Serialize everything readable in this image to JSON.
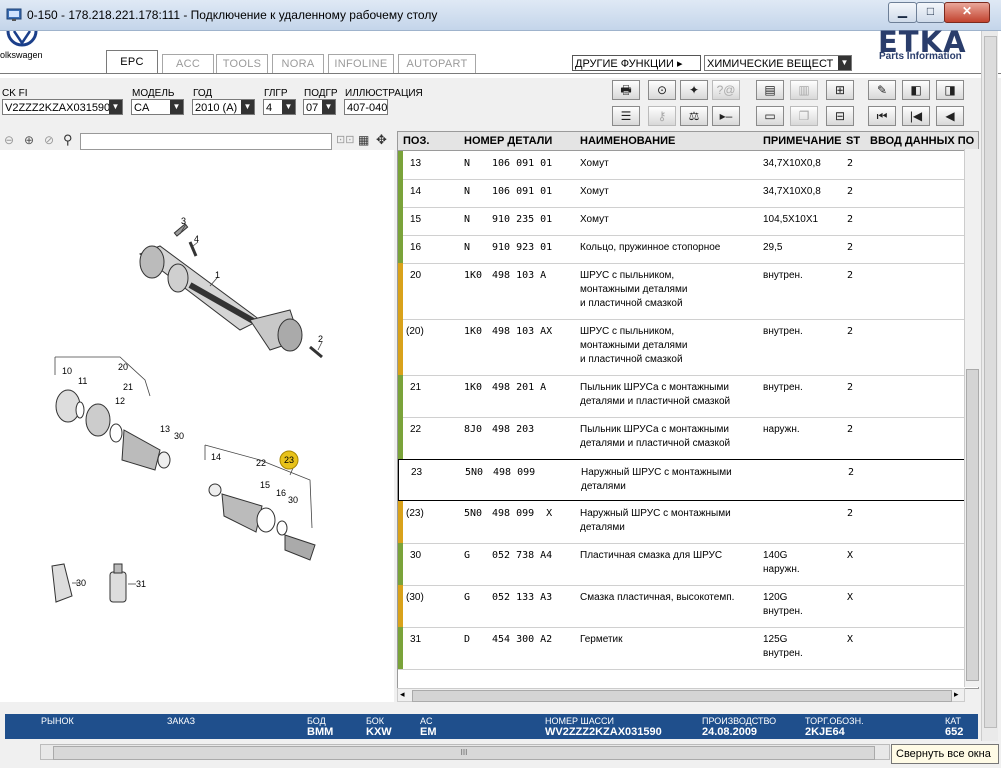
{
  "window": {
    "title": "0-150 - 178.218.221.178:111 - Подключение к удаленному рабочему столу",
    "min_symbol": "▁",
    "max_symbol": "□",
    "close_symbol": "✕"
  },
  "brand": {
    "vw_text": "olkswagen",
    "etka_logo": "ETKA",
    "etka_sub": "Parts Information"
  },
  "tabs": [
    {
      "label": "EPC",
      "active": true
    },
    {
      "label": "ACC",
      "active": false
    },
    {
      "label": "TOOLS",
      "active": false
    },
    {
      "label": "NORA",
      "active": false
    },
    {
      "label": "INFOLINE",
      "active": false
    },
    {
      "label": "AUTOPART",
      "active": false
    }
  ],
  "other_functions": {
    "label": "ДРУГИЕ ФУНКЦИИ ▸",
    "value": "ХИМИЧЕСКИЕ ВЕЩЕСТ"
  },
  "filters": {
    "vin": {
      "label": "CK FI",
      "value": "V2ZZZ2KZAX031590"
    },
    "model": {
      "label": "МОДЕЛЬ",
      "value": "CA"
    },
    "year": {
      "label": "ГОД",
      "value": "2010 (A)"
    },
    "main_group": {
      "label": "ГЛГР",
      "value": "4"
    },
    "sub_group": {
      "label": "ПОДГР",
      "value": "07"
    },
    "illustration": {
      "label": "ИЛЛЮСТРАЦИЯ",
      "value": "407-040"
    }
  },
  "table": {
    "headers": {
      "pos": "ПОЗ.",
      "part": "НОМЕР ДЕТАЛИ",
      "name": "НАИМЕНОВАНИЕ",
      "note": "ПРИМЕЧАНИЕ",
      "st": "ST",
      "input": "ВВОД ДАННЫХ ПО"
    },
    "rows": [
      {
        "pos": "13",
        "code": "N",
        "part": "106 091 01",
        "name": "Хомут",
        "note": "34,7X10X0,8",
        "st": "2",
        "lines": 1,
        "bar": "#7aa33a"
      },
      {
        "pos": "14",
        "code": "N",
        "part": "106 091 01",
        "name": "Хомут",
        "note": "34,7X10X0,8",
        "st": "2",
        "lines": 1,
        "bar": "#7aa33a"
      },
      {
        "pos": "15",
        "code": "N",
        "part": "910 235 01",
        "name": "Хомут",
        "note": "104,5X10X1",
        "st": "2",
        "lines": 1,
        "bar": "#7aa33a"
      },
      {
        "pos": "16",
        "code": "N",
        "part": "910 923 01",
        "name": "Кольцо, пружинное стопорное",
        "note": "29,5",
        "st": "2",
        "lines": 1,
        "bar": "#7aa33a"
      },
      {
        "pos": "20",
        "code": "1K0",
        "part": "498 103 A",
        "name": "ШРУС с пыльником,\nмонтажными деталями\nи пластичной смазкой",
        "note": "внутрен.",
        "st": "2",
        "lines": 3,
        "bar": "#d9a21b"
      },
      {
        "pos": "(20)",
        "code": "1K0",
        "part": "498 103 AX",
        "name": "ШРУС с пыльником,\nмонтажными деталями\nи пластичной смазкой",
        "note": "внутрен.",
        "st": "2",
        "lines": 3,
        "bar": "#d9a21b"
      },
      {
        "pos": "21",
        "code": "1K0",
        "part": "498 201 A",
        "name": "Пыльник ШРУСа с монтажными\nдеталями и пластичной смазкой",
        "note": "внутрен.",
        "st": "2",
        "lines": 2,
        "bar": "#7aa33a"
      },
      {
        "pos": "22",
        "code": "8J0",
        "part": "498 203",
        "name": "Пыльник ШРУСа с монтажными\nдеталями и пластичной смазкой",
        "note": "наружн.",
        "st": "2",
        "lines": 2,
        "bar": "#7aa33a"
      },
      {
        "pos": "23",
        "code": "5N0",
        "part": "498 099",
        "name": "Наружный ШРУС с монтажными\nдеталями",
        "note": "",
        "st": "2",
        "lines": 2,
        "bar": "#ffffff",
        "selected": true
      },
      {
        "pos": "(23)",
        "code": "5N0",
        "part": "498 099  X",
        "name": "Наружный ШРУС с монтажными\nдеталями",
        "note": "",
        "st": "2",
        "lines": 2,
        "bar": "#d9a21b"
      },
      {
        "pos": "30",
        "code": "G",
        "part": "052 738 A4",
        "name": "Пластичная смазка для ШРУС",
        "note": "140G\nнаружн.",
        "st": "X",
        "lines": 2,
        "bar": "#7aa33a"
      },
      {
        "pos": "(30)",
        "code": "G",
        "part": "052 133 A3",
        "name": "Смазка пластичная, высокотемп.",
        "note": "120G\nвнутрен.",
        "st": "X",
        "lines": 2,
        "bar": "#d9a21b"
      },
      {
        "pos": "31",
        "code": "D",
        "part": "454 300 A2",
        "name": "Герметик",
        "note": "125G\nвнутрен.",
        "st": "X",
        "lines": 2,
        "bar": "#7aa33a"
      }
    ]
  },
  "illustration_labels": [
    "3",
    "4",
    "1",
    "2",
    "20",
    "10",
    "11",
    "21",
    "12",
    "13",
    "30",
    "23",
    "14",
    "22",
    "15",
    "16",
    "30",
    "30",
    "31"
  ],
  "status": {
    "market": {
      "label": "РЫНОК",
      "value": ""
    },
    "order": {
      "label": "ЗАКАЗ",
      "value": ""
    },
    "bod": {
      "label": "БОД",
      "value": "BMM"
    },
    "bok": {
      "label": "БОК",
      "value": "KXW"
    },
    "ac": {
      "label": "AC",
      "value": "EM"
    },
    "chassis": {
      "label": "НОМЕР ШАССИ",
      "value": "WV2ZZZ2KZAX031590"
    },
    "production": {
      "label": "ПРОИЗВОДСТВО",
      "value": "24.08.2009"
    },
    "trade": {
      "label": "ТОРГ.ОБОЗН.",
      "value": "2KJE64"
    },
    "cat": {
      "label": "КАТ",
      "value": "652"
    }
  },
  "tooltip": "Свернуть все окна",
  "scroll_grip": "III",
  "colors": {
    "statusbar": "#1f4f8c",
    "bar_green": "#7aa33a",
    "bar_yellow": "#d9a21b",
    "callout": "#e8c21a"
  }
}
